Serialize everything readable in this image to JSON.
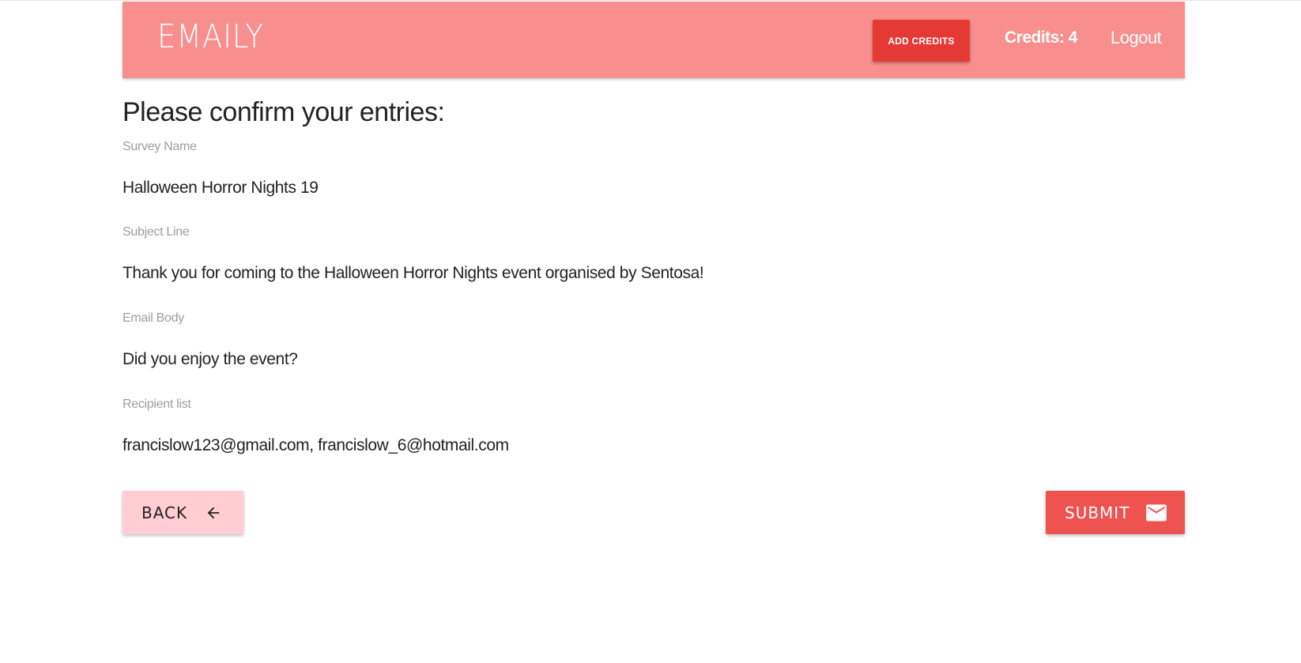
{
  "navbar": {
    "brand": "EMAILY",
    "add_credits_label": "ADD CREDITS",
    "credits_text": "Credits: 4",
    "logout_label": "Logout"
  },
  "page": {
    "title": "Please confirm your entries:"
  },
  "fields": [
    {
      "label": "Survey Name",
      "value": "Halloween Horror Nights 19"
    },
    {
      "label": "Subject Line",
      "value": "Thank you for coming to the Halloween Horror Nights event organised by Sentosa!"
    },
    {
      "label": "Email Body",
      "value": "Did you enjoy the event?"
    },
    {
      "label": "Recipient list",
      "value": "francislow123@gmail.com, francislow_6@hotmail.com"
    }
  ],
  "actions": {
    "back_label": "BACK",
    "back_icon": "arrow-back-icon",
    "submit_label": "SUBMIT",
    "submit_icon": "email-icon"
  },
  "colors": {
    "navbar_bg": "#f88e8e",
    "add_credits_bg": "#e53935",
    "back_bg": "#ffcdd2",
    "submit_bg": "#ef5350"
  }
}
